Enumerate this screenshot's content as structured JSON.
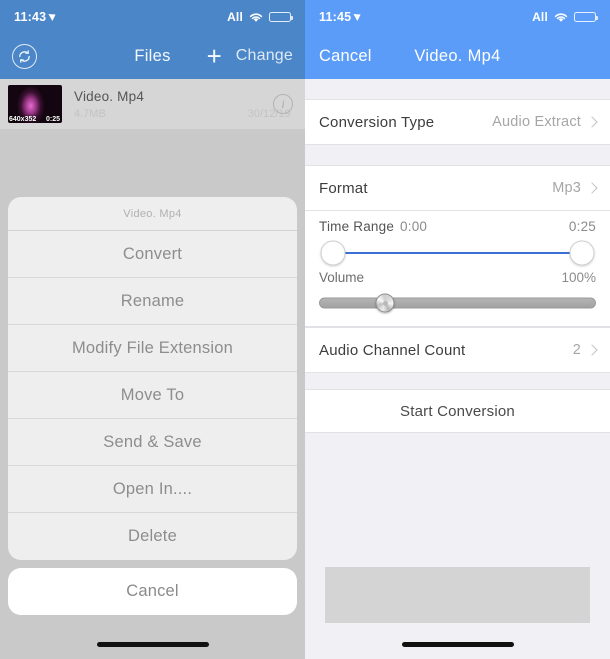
{
  "left": {
    "statusbar": {
      "time": "11:43",
      "carrier": "All",
      "location_icon": "location-arrow-icon",
      "wifi_icon": "wifi-icon",
      "battery_icon": "battery-icon"
    },
    "navbar": {
      "sync_icon": "sync-icon",
      "title": "Files",
      "add_label": "+",
      "change_label": "Change"
    },
    "file": {
      "name": "Video. Mp4",
      "size": "4.7MB",
      "date": "30/12/19",
      "thumb_resolution": "640x352",
      "thumb_duration": "0:25",
      "info_label": "i"
    },
    "sheet": {
      "header": "Video. Mp4",
      "items": [
        {
          "label": "Convert"
        },
        {
          "label": "Rename"
        },
        {
          "label": "Modify File Extension"
        },
        {
          "label": "Move To"
        },
        {
          "label": "Send & Save"
        },
        {
          "label": "Open In...."
        },
        {
          "label": "Delete"
        }
      ],
      "cancel_label": "Cancel"
    }
  },
  "right": {
    "statusbar": {
      "time": "11:45",
      "carrier": "All",
      "location_icon": "location-arrow-icon",
      "wifi_icon": "wifi-icon",
      "battery_icon": "battery-icon"
    },
    "navbar": {
      "cancel_label": "Cancel",
      "title": "Video. Mp4"
    },
    "rows": {
      "conversion_type": {
        "label": "Conversion Type",
        "value": "Audio Extract"
      },
      "format": {
        "label": "Format",
        "value": "Mp3"
      },
      "audio_channel_count": {
        "label": "Audio Channel Count",
        "value": "2"
      }
    },
    "time_range": {
      "label": "Time Range",
      "start": "0:00",
      "end": "0:25",
      "start_pct": 0,
      "end_pct": 100
    },
    "volume": {
      "label": "Volume",
      "value": "100%",
      "fill_pct": 24
    },
    "start_button": {
      "label": "Start Conversion"
    }
  },
  "colors": {
    "left_accent": "#4a86c8",
    "right_accent": "#5a9cf8",
    "range_track": "#3a6fd8",
    "page_bg": "#f1f1f5",
    "left_bg": "#c9c9c9"
  }
}
